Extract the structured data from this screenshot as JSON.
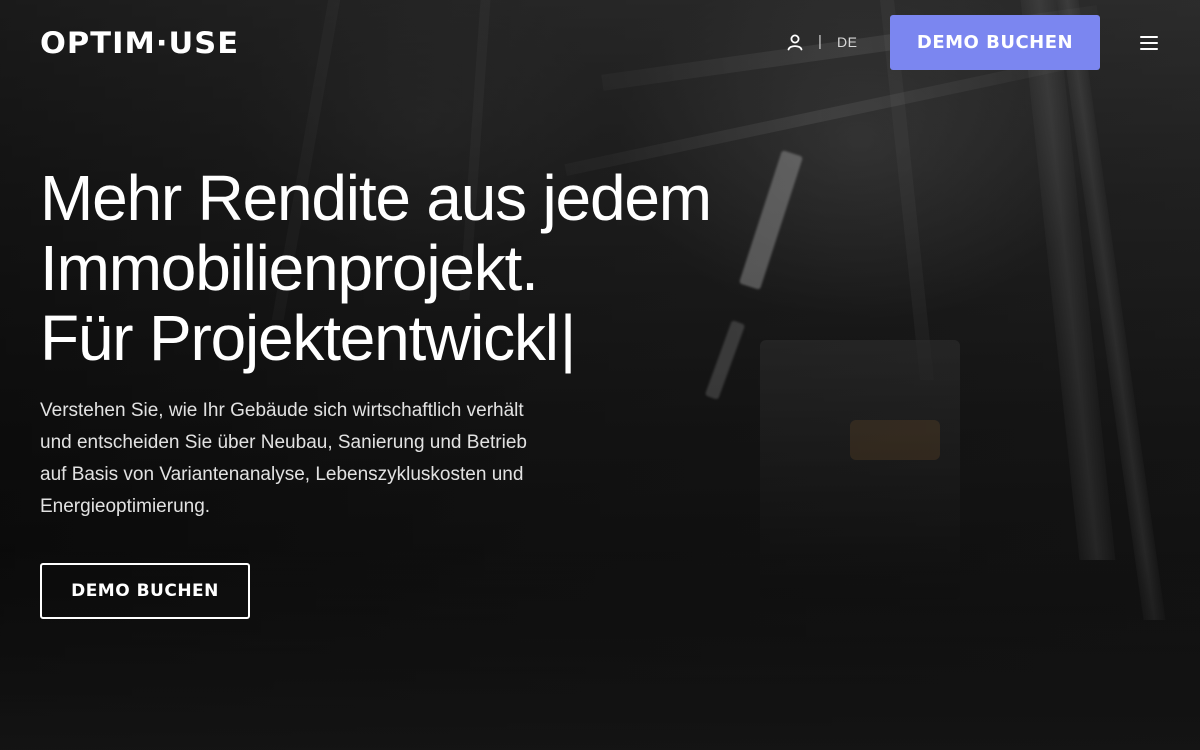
{
  "header": {
    "logo": "OPTIM·USE",
    "user_icon": "user-icon",
    "divider": "|",
    "language": "DE",
    "cta_label": "DEMO BUCHEN",
    "menu_icon": "hamburger-menu-icon"
  },
  "hero": {
    "title_lines": [
      "Mehr Rendite aus jedem",
      "Immobilienprojekt.",
      "Für Projektentwickl"
    ],
    "typing_cursor": "|",
    "text": "Verstehen Sie, wie Ihr Gebäude sich wirtschaftlich verhält und entscheiden Sie über Neubau, Sanierung und Betrieb auf Basis von Variantenanalyse, Lebenszykluskosten und Energieoptimierung.",
    "cta_label": "DEMO BUCHEN"
  },
  "colors": {
    "accent": "#7b86f0",
    "text": "#ffffff",
    "background": "#141414"
  }
}
